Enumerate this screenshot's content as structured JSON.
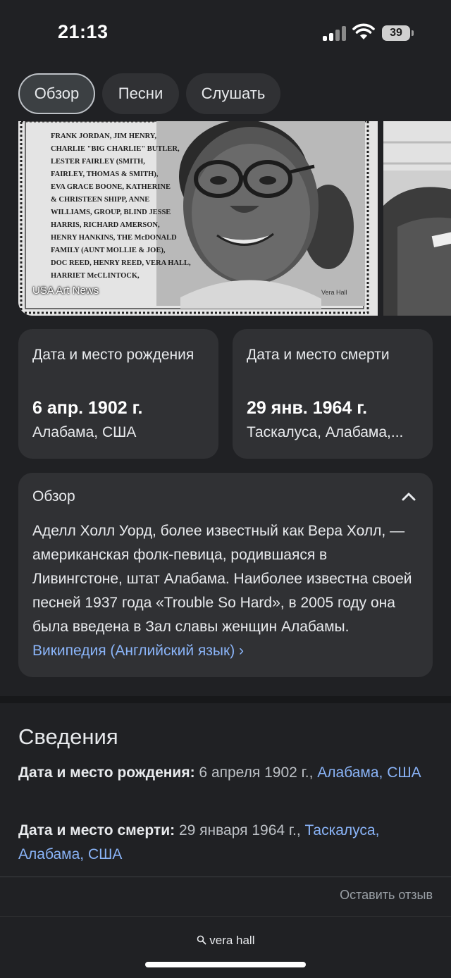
{
  "status": {
    "time": "21:13",
    "battery": "39"
  },
  "chips": [
    {
      "label": "Обзор",
      "active": true
    },
    {
      "label": "Песни",
      "active": false
    },
    {
      "label": "Слушать",
      "active": false
    }
  ],
  "image": {
    "caption": "USA Art News",
    "poster_text": [
      "FRANK JORDAN, JIM HENRY,",
      "CHARLIE \"BIG CHARLIE\" BUTLER,",
      "LESTER FAIRLEY (SMITH,",
      "FAIRLEY, THOMAS & SMITH),",
      "EVA GRACE BOONE, KATHERINE",
      "& CHRISTEEN SHIPP, ANNE",
      "WILLIAMS, GROUP, BLIND JESSE",
      "HARRIS, RICHARD AMERSON,",
      "HENRY HANKINS, THE McDONALD",
      "FAMILY (AUNT MOLLIE & JOE),",
      "DOC REED, HENRY REED, VERA HALL,",
      "HARRIET McCLINTOCK,"
    ],
    "photo_label": "Vera Hall"
  },
  "birth": {
    "title": "Дата и место рождения",
    "date": "6 апр. 1902 г.",
    "place": "Алабама, США"
  },
  "death": {
    "title": "Дата и место смерти",
    "date": "29 янв. 1964 г.",
    "place": "Таскалуса, Алабама,..."
  },
  "overview": {
    "heading": "Обзор",
    "text": "Аделл Холл Уорд, более известный как Вера Холл, — американская фолк-певица, родившаяся в Ливингстоне, штат Алабама. Наиболее известна своей песней 1937 года «Trouble So Hard», в 2005 году она была введена в Зал славы женщин Алабамы. ",
    "link": "Википедия (Английский язык) ›"
  },
  "facts": {
    "heading": "Сведения",
    "birth_label": "Дата и место рождения:",
    "birth_date": " 6 апреля 1902 г., ",
    "birth_link": "Алабама, США",
    "death_label": "Дата и место смерти:",
    "death_date": " 29 января 1964 г., ",
    "death_link": "Таскалуса, Алабама, США"
  },
  "feedback": "Оставить отзыв",
  "bottom": {
    "query": "vera hall"
  }
}
